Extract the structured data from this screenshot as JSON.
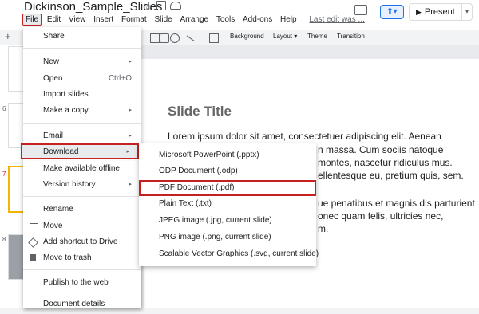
{
  "header": {
    "doc_title": "Dickinson_Sample_Slides",
    "star_icon": "star-icon",
    "menu": [
      "File",
      "Edit",
      "View",
      "Insert",
      "Format",
      "Slide",
      "Arrange",
      "Tools",
      "Add-ons",
      "Help"
    ],
    "last_edit": "Last edit was ...",
    "present_label": "Present"
  },
  "toolbar": {
    "background_label": "Background",
    "layout_label": "Layout",
    "theme_label": "Theme",
    "transition_label": "Transition"
  },
  "filmstrip": {
    "slide_numbers": [
      "6",
      "7",
      "8"
    ]
  },
  "slide": {
    "title": "Slide Title",
    "lines": [
      "Lorem ipsum dolor sit amet, consectetuer adipiscing elit. Aenean",
      "n massa. Cum sociis natoque",
      "montes, nascetur ridiculus mus.",
      "ellentesque eu, pretium quis, sem.",
      "ue penatibus et magnis dis parturient",
      "onec quam felis, ultricies nec,",
      "m."
    ]
  },
  "file_menu": {
    "items": [
      {
        "label": "Share"
      },
      {
        "label": "New",
        "submenu": true
      },
      {
        "label": "Open",
        "shortcut": "Ctrl+O"
      },
      {
        "label": "Import slides"
      },
      {
        "label": "Make a copy",
        "submenu": true
      },
      {
        "label": "Email",
        "submenu": true
      },
      {
        "label": "Download",
        "submenu": true
      },
      {
        "label": "Make available offline"
      },
      {
        "label": "Version history",
        "submenu": true
      },
      {
        "label": "Rename"
      },
      {
        "label": "Move",
        "icon": "folder-icon"
      },
      {
        "label": "Add shortcut to Drive",
        "icon": "drive-shortcut-icon"
      },
      {
        "label": "Move to trash",
        "icon": "trash-icon"
      },
      {
        "label": "Publish to the web"
      },
      {
        "label": "Document details"
      }
    ]
  },
  "download_submenu": {
    "items": [
      "Microsoft PowerPoint (.pptx)",
      "ODP Document (.odp)",
      "PDF Document (.pdf)",
      "Plain Text (.txt)",
      "JPEG image (.jpg, current slide)",
      "PNG image (.png, current slide)",
      "Scalable Vector Graphics (.svg, current slide)"
    ]
  },
  "colors": {
    "highlight": "#c5221f",
    "accent": "#1a73e8"
  }
}
